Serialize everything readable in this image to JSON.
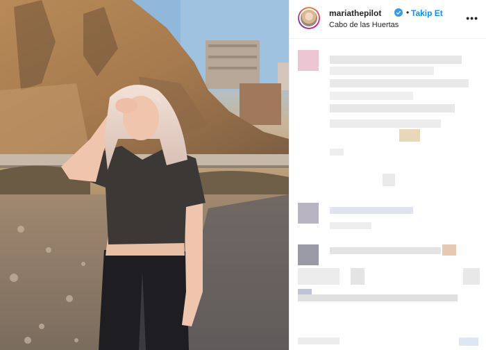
{
  "post": {
    "username": "mariathepilot",
    "follow_label": "Takip Et",
    "location": "Cabo de las Huertas",
    "separator": "•",
    "more_label": "•••"
  },
  "icons": {
    "verified": "verified-badge-icon",
    "more": "more-options-icon"
  },
  "colors": {
    "accent": "#0095f6",
    "text": "#262626",
    "verified": "#3897f0"
  }
}
